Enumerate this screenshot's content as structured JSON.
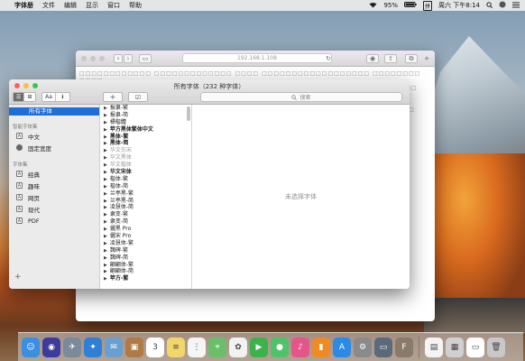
{
  "menubar": {
    "apple_glyph": "",
    "app_name": "字体册",
    "items": [
      "文件",
      "编辑",
      "显示",
      "窗口",
      "帮助"
    ],
    "battery": "95%",
    "input_source": "拼",
    "clock": "周六 下午8:14"
  },
  "browser": {
    "url": "192.168.1.108",
    "placeholder_text_rows": [
      "□□□□□□□□□□□□ □□□□□□□□□□□□□ □□□□ □□□□□□□□□□□□□□□□□□ □□□□□□□□ □□□□",
      "□□□□□□□□□□ □□□□□□□□ □□□□□□□□□□ □□□□□□□□□□□ □□□□□□□□ □□□□□□□",
      "□□□□□□□□□□□□□□ □□□□□□□□□□□□□□□□ □□□□□□□□□□□□ □□□□□□□□□ □□□□□□",
      "□□□□□□□□ □□□□□□□□□□□□ □□□□□□□□□□□□□□□ □□□□□□□□□□ □□□□□□□□□",
      "□□□□□□□□□□□□□□□□□□□ □□□□□□□□ □□□□□□□□□□□□□ □□□□□□□□□□□□ □□□□□"
    ]
  },
  "fontbook": {
    "title": "所有字体（232 种字体）",
    "search_placeholder": "搜索",
    "view_toggle": [
      "☰",
      "⊞",
      "Aa",
      "ℹ"
    ],
    "add_label": "+",
    "check_label": "☑",
    "sidebar": {
      "selected": "所有字体",
      "smart_header": "智能字体集",
      "smart_items": [
        {
          "label": "中文",
          "icon": "collection-icon"
        },
        {
          "label": "固定宽度",
          "icon": "gear-icon"
        }
      ],
      "collections_header": "字体集",
      "collections": [
        {
          "label": "经典",
          "icon": "collection-icon"
        },
        {
          "label": "趣味",
          "icon": "collection-icon"
        },
        {
          "label": "网页",
          "icon": "collection-icon"
        },
        {
          "label": "现代",
          "icon": "collection-icon"
        },
        {
          "label": "PDF",
          "icon": "collection-icon"
        }
      ],
      "add_button": "+"
    },
    "fonts": [
      {
        "name": "报隶-繁",
        "style": "normal"
      },
      {
        "name": "报隶-简",
        "style": "normal"
      },
      {
        "name": "標楷體",
        "style": "normal"
      },
      {
        "name": "苹方黑体繁体中文",
        "style": "bold"
      },
      {
        "name": "黑体-繁",
        "style": "bold"
      },
      {
        "name": "黑体-简",
        "style": "bold"
      },
      {
        "name": "华文仿宋",
        "style": "dim"
      },
      {
        "name": "华文黑体",
        "style": "dim"
      },
      {
        "name": "华文楷体",
        "style": "dim"
      },
      {
        "name": "华文宋体",
        "style": "bold"
      },
      {
        "name": "楷体-繁",
        "style": "normal"
      },
      {
        "name": "楷体-简",
        "style": "normal"
      },
      {
        "name": "兰亭黑-繁",
        "style": "normal"
      },
      {
        "name": "兰亭黑-简",
        "style": "normal"
      },
      {
        "name": "凌慧体-简",
        "style": "normal"
      },
      {
        "name": "隶变-繁",
        "style": "normal"
      },
      {
        "name": "隶变-简",
        "style": "normal"
      },
      {
        "name": "儷黑 Pro",
        "style": "normal"
      },
      {
        "name": "儷宋 Pro",
        "style": "normal"
      },
      {
        "name": "凌慧体-繁",
        "style": "normal"
      },
      {
        "name": "魏碑-繁",
        "style": "normal"
      },
      {
        "name": "魏碑-简",
        "style": "normal"
      },
      {
        "name": "翩翩体-繁",
        "style": "normal"
      },
      {
        "name": "翩翩体-简",
        "style": "normal"
      },
      {
        "name": "苹方-繁",
        "style": "bold"
      }
    ],
    "empty_preview": "未选择字体"
  },
  "dock": {
    "apps": [
      {
        "name": "finder-icon",
        "color": "#3a8fe0",
        "glyph": "☺"
      },
      {
        "name": "siri-icon",
        "color": "#3b3b9e",
        "glyph": "◉"
      },
      {
        "name": "launchpad-icon",
        "color": "#7a8a9a",
        "glyph": "✈"
      },
      {
        "name": "safari-icon",
        "color": "#2f7fd6",
        "glyph": "✦"
      },
      {
        "name": "mail-photo-icon",
        "color": "#6aa0d0",
        "glyph": "✉"
      },
      {
        "name": "contacts-icon",
        "color": "#b07a44",
        "glyph": "▣"
      },
      {
        "name": "calendar-icon",
        "color": "#ffffff",
        "glyph": "3"
      },
      {
        "name": "notes-icon",
        "color": "#f1d66a",
        "glyph": "≡"
      },
      {
        "name": "reminders-icon",
        "color": "#f5f5f5",
        "glyph": "⋮"
      },
      {
        "name": "maps-icon",
        "color": "#6abf6a",
        "glyph": "⌖"
      },
      {
        "name": "photos-icon",
        "color": "#f2f2f2",
        "glyph": "✿"
      },
      {
        "name": "facetime-icon",
        "color": "#3cb34a",
        "glyph": "▶"
      },
      {
        "name": "messages-icon",
        "color": "#4fc36a",
        "glyph": "●"
      },
      {
        "name": "itunes-icon",
        "color": "#e6558a",
        "glyph": "♪"
      },
      {
        "name": "ibooks-icon",
        "color": "#f08a24",
        "glyph": "▮"
      },
      {
        "name": "appstore-icon",
        "color": "#2a8ae6",
        "glyph": "A"
      },
      {
        "name": "system-preferences-icon",
        "color": "#8a8a8a",
        "glyph": "⚙"
      },
      {
        "name": "screenshot-icon",
        "color": "#5a6a7a",
        "glyph": "▭"
      },
      {
        "name": "fontbook-icon",
        "color": "#8a7a6a",
        "glyph": "F"
      }
    ],
    "right_items": [
      {
        "name": "document-icon",
        "color": "#f4f4f4",
        "glyph": "▤"
      },
      {
        "name": "stack-icon",
        "color": "#d0d0d0",
        "glyph": "▦"
      },
      {
        "name": "window-thumb-icon",
        "color": "#ffffff",
        "glyph": "▭"
      },
      {
        "name": "trash-icon",
        "color": "#c8c8c8",
        "glyph": "🗑"
      }
    ]
  }
}
